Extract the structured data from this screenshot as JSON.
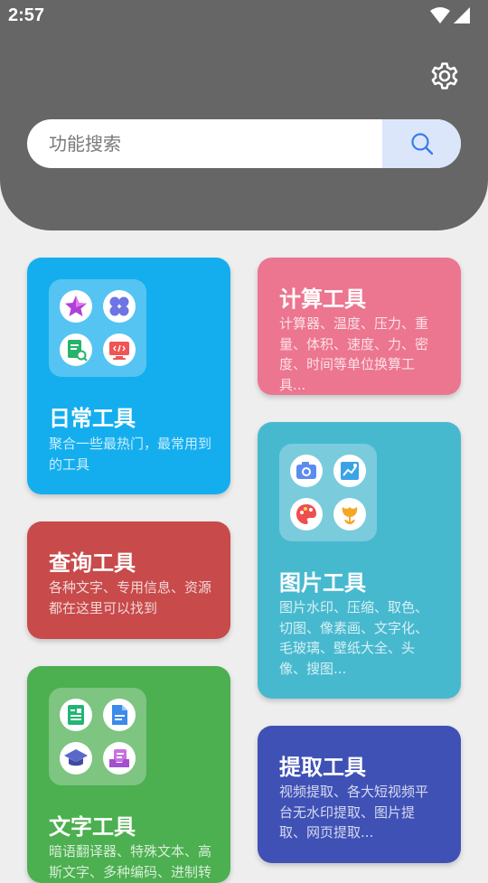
{
  "status": {
    "time": "2:57"
  },
  "search": {
    "placeholder": "功能搜索"
  },
  "cards": {
    "daily": {
      "title": "日常工具",
      "desc": "聚合一些最热门，最常用到的工具",
      "color": "#14aeef"
    },
    "calc": {
      "title": "计算工具",
      "desc": "计算器、温度、压力、重量、体积、速度、力、密度、时间等单位换算工具...",
      "color": "#ec7590"
    },
    "query": {
      "title": "查询工具",
      "desc": "各种文字、专用信息、资源都在这里可以找到",
      "color": "#c84a4a"
    },
    "image": {
      "title": "图片工具",
      "desc": "图片水印、压缩、取色、切图、像素画、文字化、毛玻璃、壁纸大全、头像、搜图...",
      "color": "#47b9cf"
    },
    "text": {
      "title": "文字工具",
      "desc": "暗语翻译器、特殊文本、高斯文字、多种编码、进制转换...",
      "color": "#4caf50"
    },
    "extract": {
      "title": "提取工具",
      "desc": "视频提取、各大短视频平台无水印提取、图片提取、网页提取...",
      "color": "#3f51b5"
    }
  }
}
